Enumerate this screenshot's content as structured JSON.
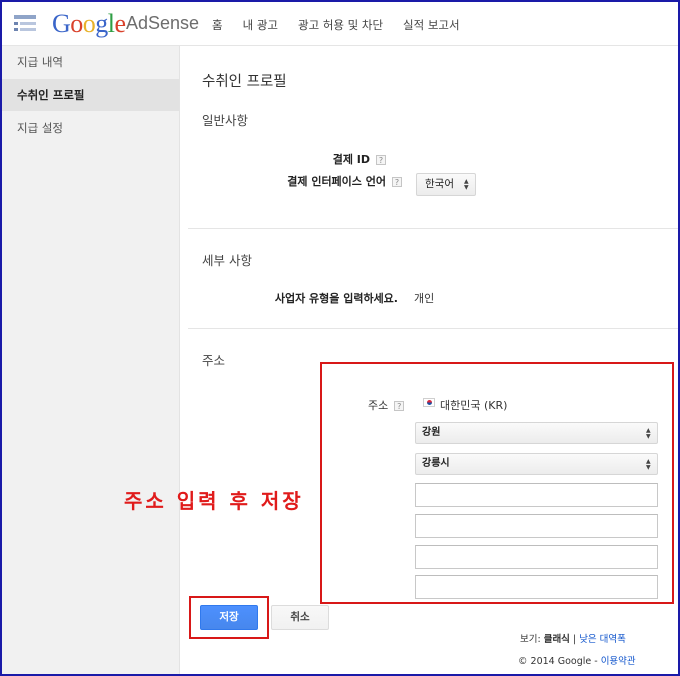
{
  "header": {
    "logo_google": "Google",
    "logo_product": "AdSense",
    "nav": [
      {
        "label": "홈"
      },
      {
        "label": "내 광고"
      },
      {
        "label": "광고 허용 및 차단"
      },
      {
        "label": "실적 보고서"
      }
    ]
  },
  "sidebar": {
    "items": [
      {
        "label": "지급 내역",
        "active": false
      },
      {
        "label": "수취인 프로필",
        "active": true
      },
      {
        "label": "지급 설정",
        "active": false
      }
    ]
  },
  "main": {
    "page_title": "수취인 프로필",
    "general": {
      "title": "일반사항",
      "payment_id_label": "결제 ID",
      "payment_lang_label": "결제 인터페이스 언어",
      "payment_lang_value": "한국어",
      "help_glyph": "?"
    },
    "details": {
      "title": "세부 사항",
      "business_type_label": "사업자 유형을 입력하세요.",
      "business_type_value": "개인"
    },
    "address": {
      "title": "주소",
      "label": "주소",
      "country": "대한민국 (KR)",
      "province": "강원",
      "city": "강릉시",
      "lines": [
        "",
        "",
        "",
        ""
      ]
    },
    "annotation": "주소 입력 후 저장",
    "buttons": {
      "save": "저장",
      "cancel": "취소"
    }
  },
  "footer": {
    "view_prefix": "보기: ",
    "view_current": "클래식",
    "view_sep": " | ",
    "view_link": "낮은 대역폭",
    "copyright": "© 2014 Google - ",
    "terms_link": "이용약관"
  },
  "colors": {
    "accent_blue": "#4d90fe",
    "annotation_red": "#d81818",
    "frame_blue": "#1a1aa8"
  }
}
